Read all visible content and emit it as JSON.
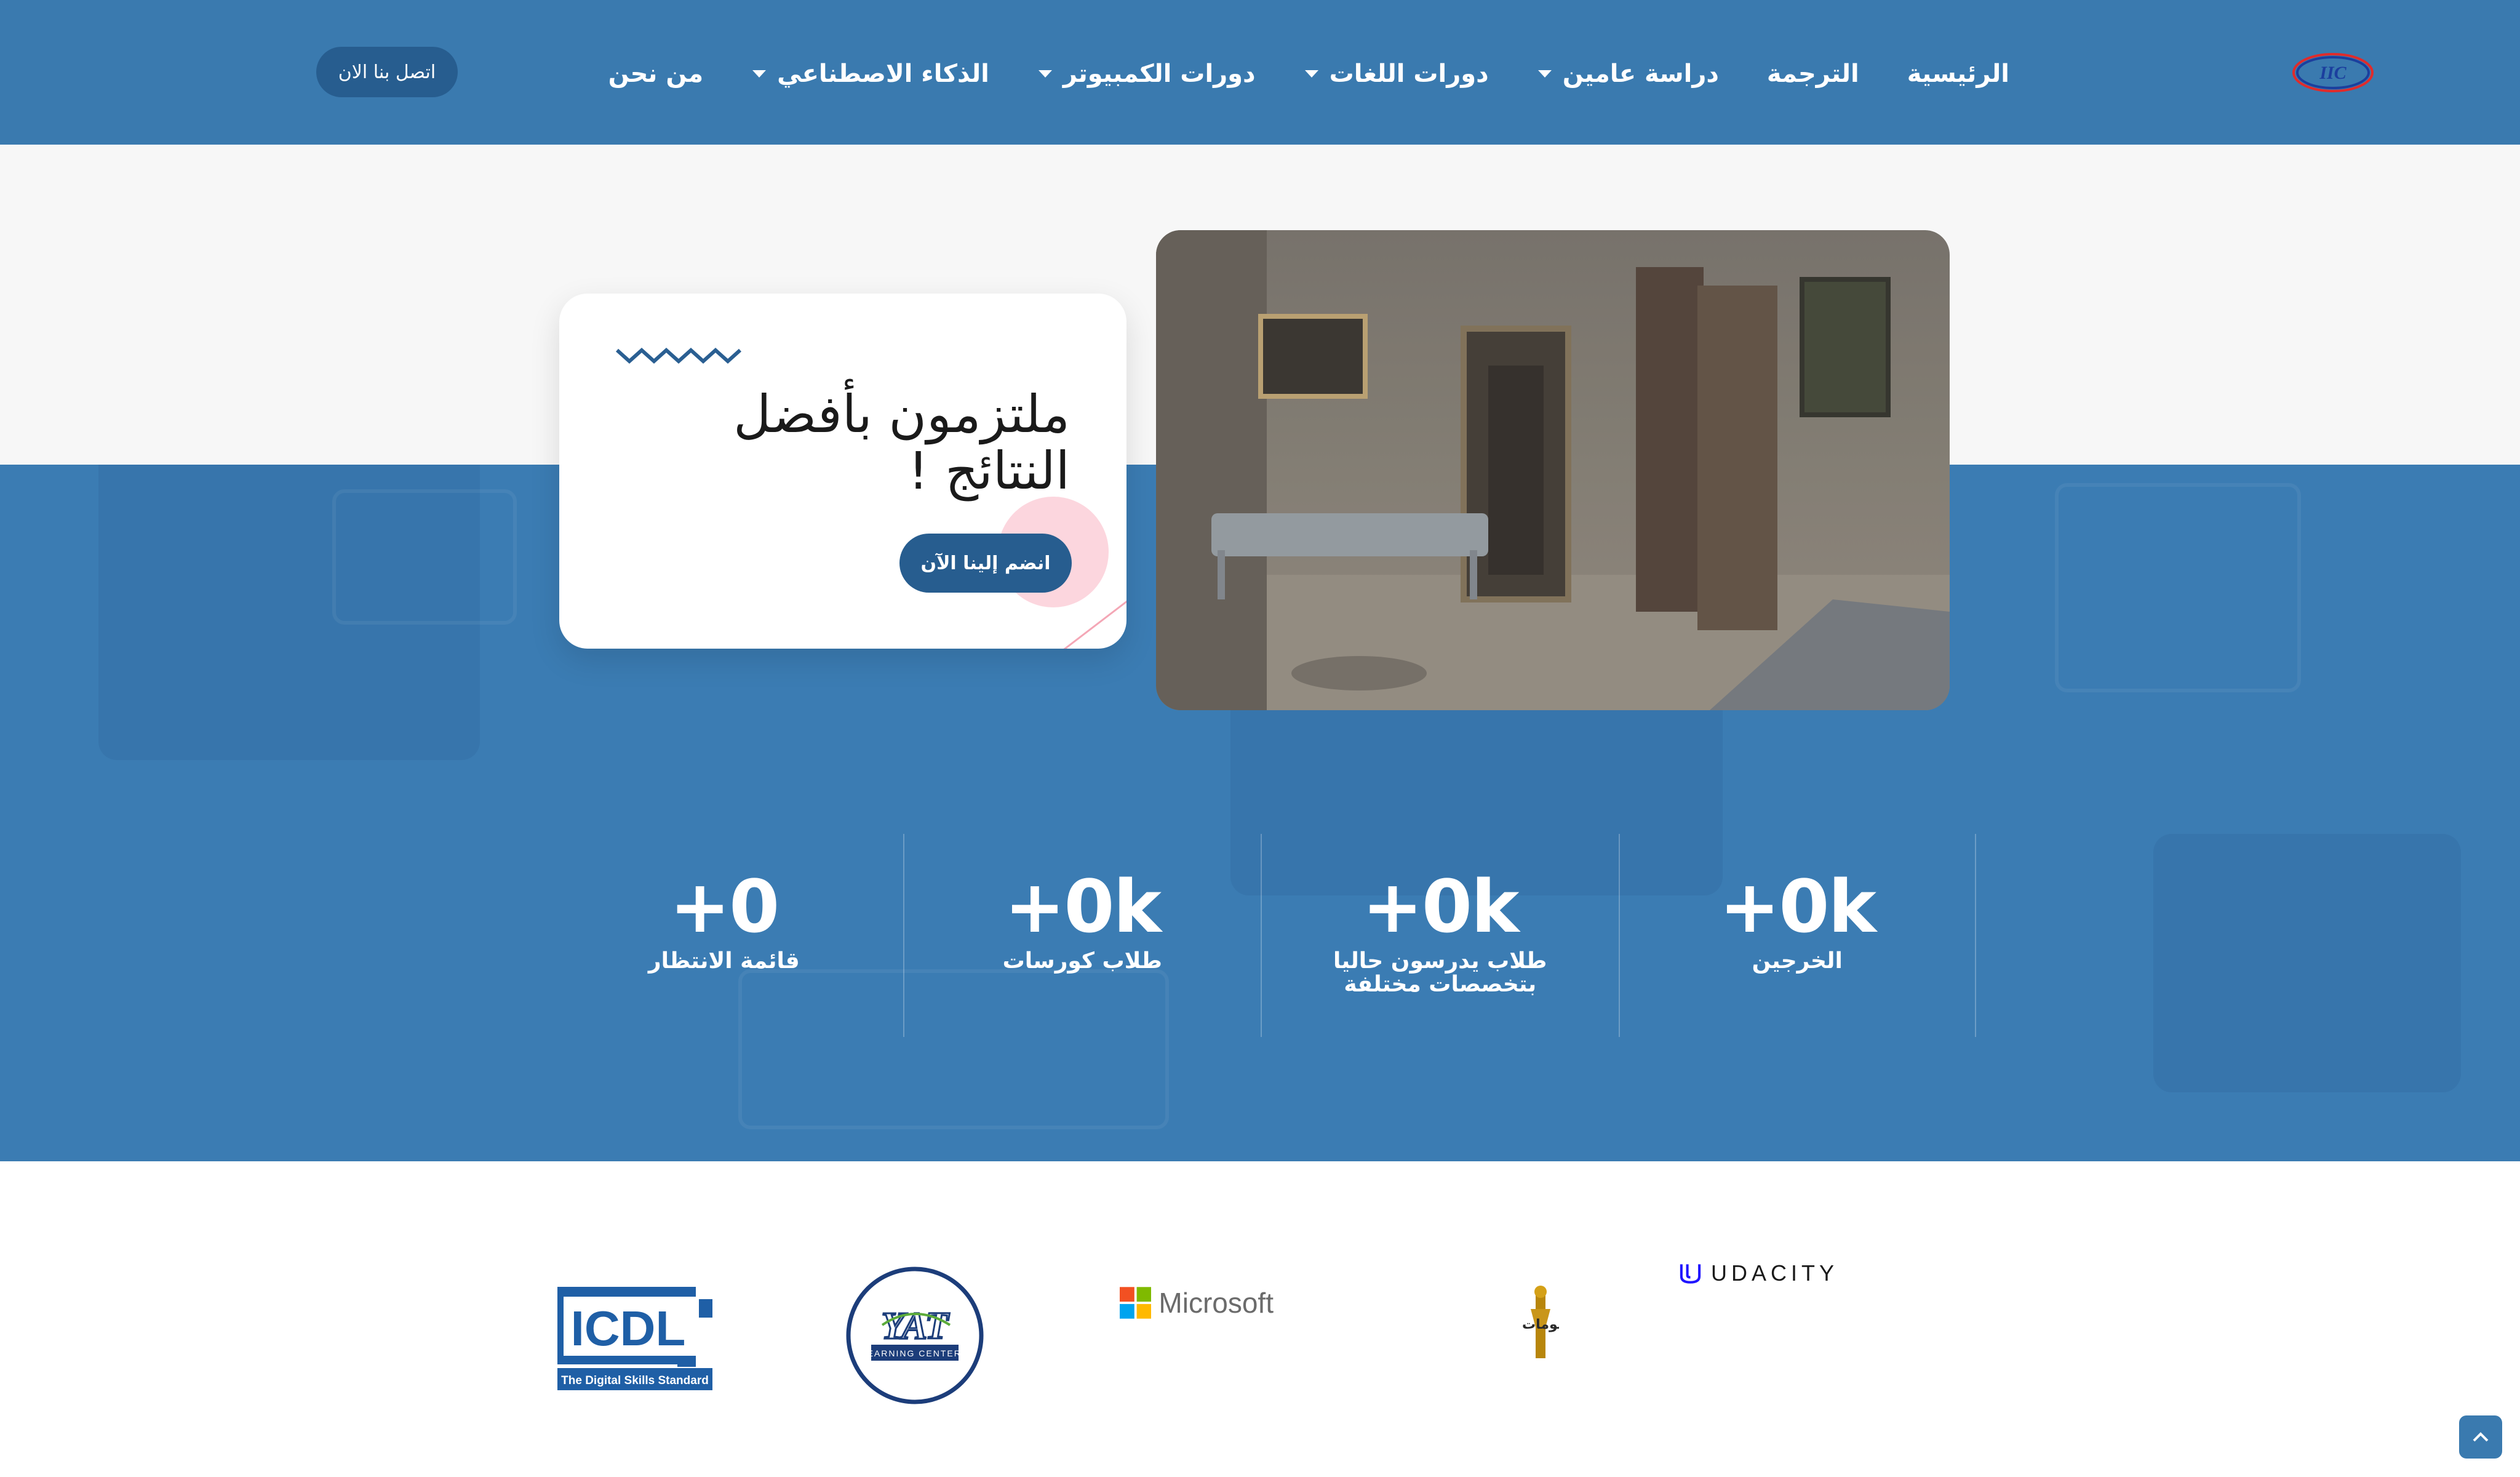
{
  "header": {
    "logo_text": "IIC",
    "nav": [
      {
        "label": "الرئيسية",
        "has_dropdown": false
      },
      {
        "label": "الترجمة",
        "has_dropdown": false
      },
      {
        "label": "دراسة عامين",
        "has_dropdown": true
      },
      {
        "label": "دورات اللغات",
        "has_dropdown": true
      },
      {
        "label": "دورات الكمبيوتر",
        "has_dropdown": true
      },
      {
        "label": "الذكاء الاصطناعي",
        "has_dropdown": true
      },
      {
        "label": "من نحن",
        "has_dropdown": false
      }
    ],
    "contact_button": "اتصل بنا الان"
  },
  "hero": {
    "title": "ملتزمون بأفضل النتائج !",
    "join_button": "انضم إلينا الآن"
  },
  "stats": [
    {
      "value": "+0k",
      "label": "الخرجين"
    },
    {
      "value": "+0k",
      "label": "طلاب يدرسون حاليا بتخصصات مختلفة"
    },
    {
      "value": "+0k",
      "label": "طلاب كورسات"
    },
    {
      "value": "+0",
      "label": "قائمة الانتظار"
    }
  ],
  "partners": {
    "icdl": {
      "name": "ICDL",
      "tagline": "The Digital Skills Standard"
    },
    "yat": {
      "name": "YAT",
      "tagline": "LEARNING CENTERS"
    },
    "microsoft": {
      "name": "Microsoft"
    },
    "mcit": {
      "name": "وزارة الاتصالات وتكنولوجيا المعلومات"
    },
    "udacity": {
      "name": "UDACITY"
    }
  },
  "colors": {
    "brand_blue": "#3a7aaf",
    "button_blue": "#275d8f",
    "accent_pink": "#f7b4c2"
  },
  "icons": {
    "dropdown": "chevron-down-icon",
    "back_to_top": "chevron-up-icon"
  }
}
